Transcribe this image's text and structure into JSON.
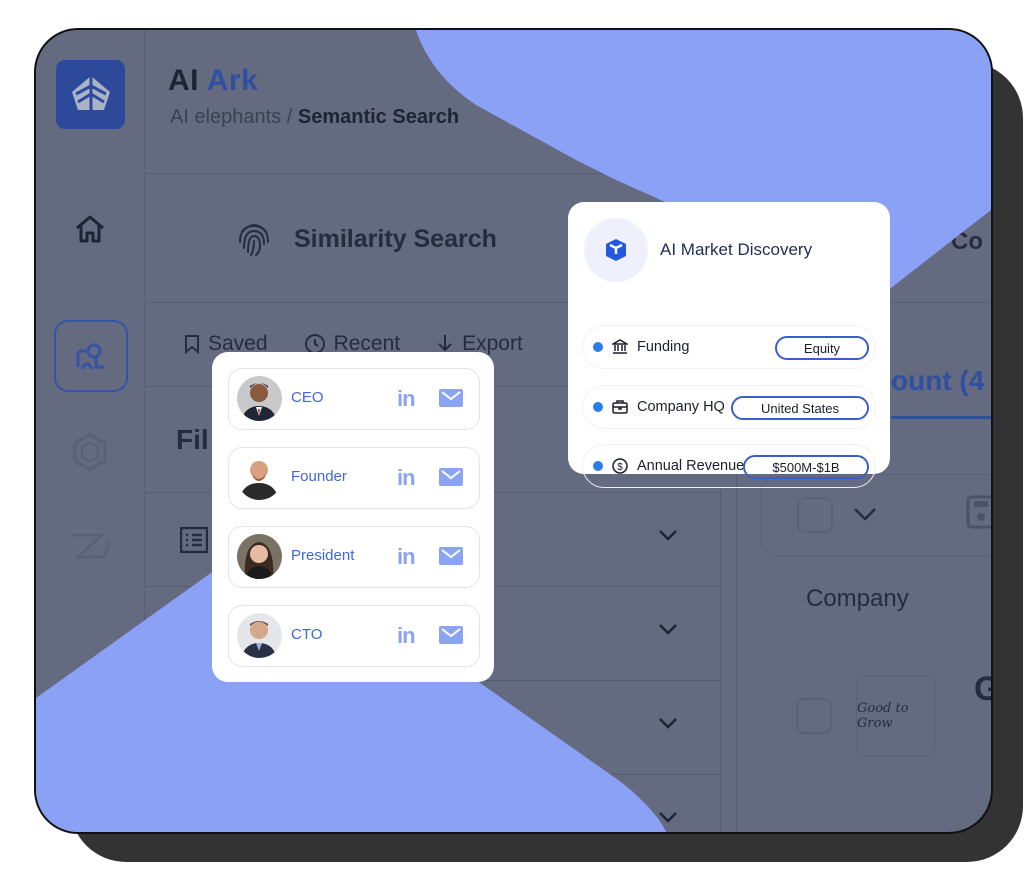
{
  "app": {
    "title_part1": "AI",
    "title_part2": "Ark",
    "breadcrumb_parent": "AI elephants /",
    "breadcrumb_current": "Semantic Search"
  },
  "sidebar": {
    "items": [
      {
        "name": "home",
        "icon": "home-icon",
        "active": false
      },
      {
        "name": "people-search",
        "icon": "people-search-icon",
        "active": true
      },
      {
        "name": "hexagon",
        "icon": "hexagon-icon",
        "active": false
      },
      {
        "name": "send",
        "icon": "send-icon",
        "active": false
      }
    ]
  },
  "tabs": {
    "similarity": "Similarity Search",
    "other_partial": "Co"
  },
  "toolbar": {
    "saved": "Saved",
    "recent": "Recent",
    "export": "Export"
  },
  "filters": {
    "title_partial": "Fil"
  },
  "results": {
    "account_tab_partial": "ount (4",
    "company_header": "Company",
    "company_logo_text": "Good to Grow",
    "company_name_partial": "G"
  },
  "discovery": {
    "title": "AI Market Discovery",
    "rows": [
      {
        "label": "Funding",
        "icon": "bank-icon",
        "value": "Equity"
      },
      {
        "label": "Company HQ",
        "icon": "briefcase-icon",
        "value": "United States"
      },
      {
        "label": "Annual Revenue",
        "icon": "dollar-icon",
        "value": "$500M-$1B"
      }
    ]
  },
  "people": [
    {
      "role": "CEO",
      "linkedin": "in"
    },
    {
      "role": "Founder",
      "linkedin": "in"
    },
    {
      "role": "President",
      "linkedin": "in"
    },
    {
      "role": "CTO",
      "linkedin": "in"
    }
  ],
  "colors": {
    "accent": "#3f67d6",
    "brand": "#2f4fa0",
    "blob": "#8aa1f6",
    "overlay": "#646a7f",
    "dot": "#2a7de8"
  }
}
